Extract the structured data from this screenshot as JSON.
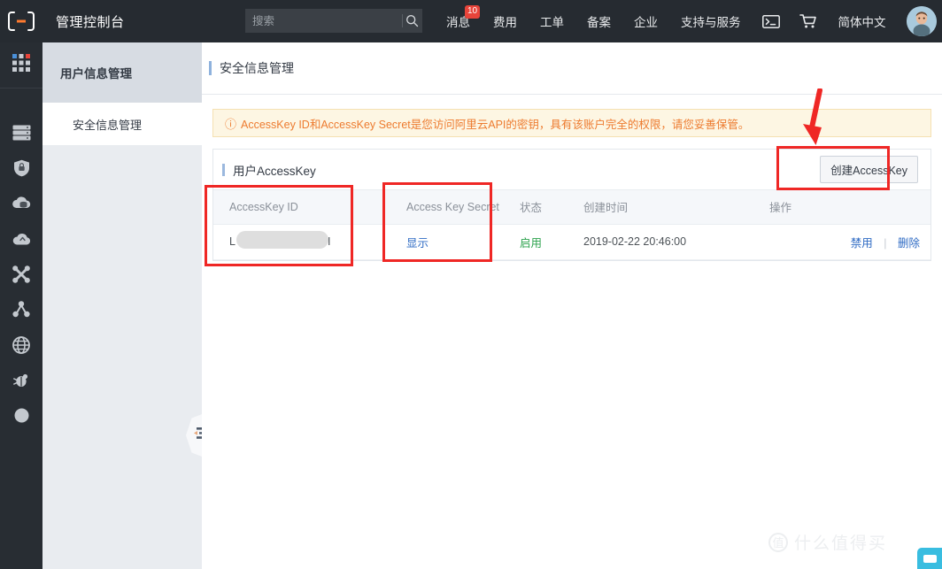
{
  "header": {
    "logo_icon": "alibaba-cloud-logo-icon",
    "console_title": "管理控制台",
    "search": {
      "placeholder": "搜索",
      "value": "",
      "icon": "search-icon"
    },
    "nav": [
      {
        "label": "消息",
        "badge": "10"
      },
      {
        "label": "费用",
        "badge": ""
      },
      {
        "label": "工单",
        "badge": ""
      },
      {
        "label": "备案",
        "badge": ""
      },
      {
        "label": "企业",
        "badge": ""
      },
      {
        "label": "支持与服务",
        "badge": ""
      }
    ],
    "terminal_icon": "terminal-icon",
    "cart_icon": "shopping-cart-icon",
    "language": "简体中文",
    "avatar_icon": "user-avatar"
  },
  "rail": {
    "items": [
      {
        "icon": "apps-grid-icon",
        "name": "products-grid"
      },
      {
        "icon": "server-icon",
        "name": "ecs"
      },
      {
        "icon": "shield-icon",
        "name": "security"
      },
      {
        "icon": "cloud-database-icon",
        "name": "database"
      },
      {
        "icon": "cloud-icon",
        "name": "cloud-storage"
      },
      {
        "icon": "network-nodes-icon",
        "name": "network"
      },
      {
        "icon": "share-nodes-icon",
        "name": "cdn"
      },
      {
        "icon": "globe-icon",
        "name": "domain"
      },
      {
        "icon": "bug-icon",
        "name": "monitor"
      },
      {
        "icon": "circle-icon",
        "name": "more"
      }
    ]
  },
  "sidebar": {
    "header": "用户信息管理",
    "items": [
      {
        "label": "安全信息管理"
      }
    ],
    "collapse_icon": "collapse-menu-icon"
  },
  "main": {
    "page_title": "安全信息管理",
    "alert": {
      "icon": "warning-circle-icon",
      "text": "AccessKey ID和AccessKey Secret是您访问阿里云API的密钥，具有该账户完全的权限，请您妥善保管。"
    },
    "panel": {
      "title": "用户AccessKey",
      "create_button": "创建AccessKey"
    },
    "table": {
      "columns": [
        "AccessKey ID",
        "Access Key Secret",
        "状态",
        "创建时间",
        "操作"
      ],
      "rows": [
        {
          "id_prefix": "L",
          "id_suffix": "I",
          "secret_link": "显示",
          "status": "启用",
          "created": "2019-02-22 20:46:00",
          "action_disable": "禁用",
          "action_delete": "删除"
        }
      ]
    }
  },
  "annotations": {
    "arrow_icon": "red-down-arrow",
    "boxes": [
      "accesskey-id-column",
      "access-key-secret-column",
      "create-accesskey-button"
    ]
  },
  "watermark": {
    "mark": "值",
    "text": "什么值得买"
  },
  "colors": {
    "header_bg": "#262b31",
    "rail_bg": "#282d33",
    "sidebar_bg": "#e9ecf0",
    "accent_blue": "#2f6bc4",
    "alert_orange": "#ed7b2f",
    "status_green": "#2ba24c",
    "annotation_red": "#ef2725",
    "badge_red": "#e8443a"
  }
}
